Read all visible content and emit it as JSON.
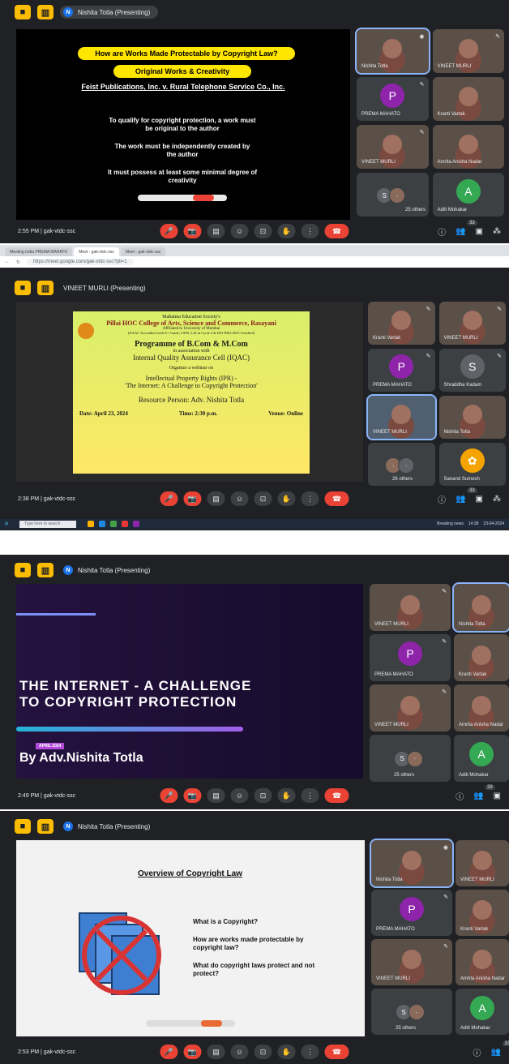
{
  "panel1": {
    "presenter": "Nishita Totla (Presenting)",
    "title": "How are Works Made Protectable by Copyright Law?",
    "subtitle": "Original Works & Creativity",
    "case": "Feist Publications, Inc. v. Rural Telephone Service Co., Inc.",
    "points": [
      "To qualify for copyright protection, a work must be original to the author",
      "The work must be independently created by the author",
      "It must possess at least some minimal degree of creativity"
    ],
    "tiles": [
      "Nishita Totla",
      "VINEET MURLI",
      "PREMA MAHATO",
      "Kranti Vartak",
      "VINEET MURLI",
      "Amrita Anisha Nadar",
      "25 others",
      "Aditi Mohakar"
    ],
    "time": "2:55 PM",
    "meeting": "gak-vtdc-ssc",
    "participants": "33"
  },
  "panel2": {
    "tabs": [
      "Meeting India PREMA MAHATO",
      "Meet - gak-vtdc-ssc",
      "Meet - gak-vtdc-ssc"
    ],
    "url": "https://meet.google.com/gak-vtdc-ssc?pli=1",
    "presenter": "VINEET MURLI (Presenting)",
    "society": "Mahatma Education Society's",
    "college": "Pillai HOC College of Arts, Science and Commerce, Rasayani",
    "affiliation": "Affiliated to University of Mumbai",
    "accreditation": "(NAAC Accredited with A+ Grade, CSPA 3.26 in Cycle 2 & ISO 9001:2015 Certified)",
    "programme": "Programme of B.Com & M.Com",
    "assoc": "in association with",
    "cell": "Internal Quality Assurance Cell (IQAC)",
    "organize": "Organize a webinar on",
    "topic1": "Intellectual Property Rights (IPR) -",
    "topic2": "'The Internet: A Challenge to Copyright Protection'",
    "resource": "Resource Person: Adv. Nishita Totla",
    "date": "Date: April 23, 2024",
    "timeslot": "Time: 2:30 p.m.",
    "venue": "Venue: Online",
    "tiles": [
      "Kranti Vartak",
      "VINEET MURLI",
      "PREMA MAHATO",
      "Shraddha Kadam",
      "VINEET MURLI",
      "Nishita Totla",
      "26 others",
      "Sanand Sumesh"
    ],
    "time": "2:38 PM",
    "meeting": "gak-vtdc-ssc",
    "participants": "33",
    "search": "Type here to search",
    "news": "Breaking news",
    "clock": "14:38",
    "date_tb": "23-04-2024"
  },
  "panel3": {
    "presenter": "Nishita Totla (Presenting)",
    "title1": "THE INTERNET - A CHALLENGE",
    "title2": "TO COPYRIGHT PROTECTION",
    "tag": "APRIL 2024",
    "author": "By Adv.Nishita Totla",
    "tiles": [
      "VINEET MURLI",
      "Nishita Totla",
      "PREMA MAHATO",
      "Kranti Vartak",
      "VINEET MURLI",
      "Amrita Anisha Nadar",
      "25 others",
      "Aditi Mohakar"
    ],
    "time": "2:49 PM",
    "meeting": "gak-vtdc-ssc",
    "participants": "33"
  },
  "panel4": {
    "presenter": "Nishita Totla (Presenting)",
    "title": "Overview of Copyright Law",
    "q1": "What is a Copyright?",
    "q2": "How are works made protectable by copyright law?",
    "q3": "What do copyright laws protect and not protect?",
    "tiles": [
      "Nishita Totla",
      "VINEET MURLI",
      "PREMA MAHATO",
      "Kranti Vartak",
      "VINEET MURLI",
      "Amrita Anisha Nadar",
      "25 others",
      "Aditi Mohakar"
    ],
    "time": "2:53 PM",
    "meeting": "gak-vtdc-ssc",
    "participants": "33"
  },
  "controls": {
    "mic": "🎤",
    "cam": "📷",
    "cc": "▤",
    "emoji": "☺",
    "present": "⊡",
    "hand": "✋",
    "more": "⋮",
    "end": "☎"
  },
  "colors": {
    "meet_bg": "#202124",
    "tile": "#3c4043",
    "end_red": "#ea4335"
  }
}
